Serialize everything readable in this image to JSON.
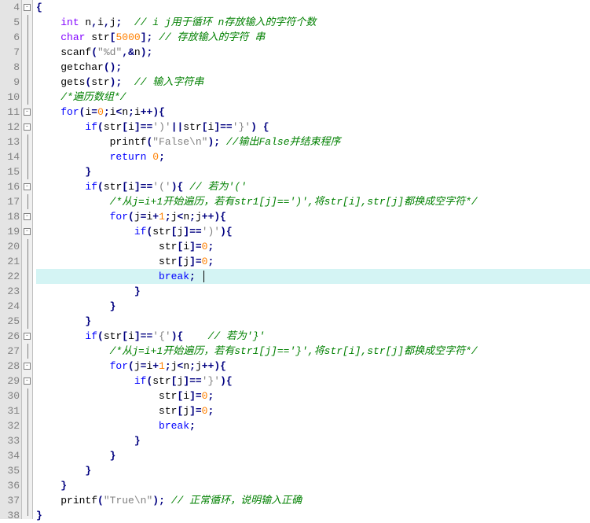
{
  "editor": {
    "active_line": 22,
    "gutter_start": 4,
    "gutter_end": 38,
    "fold_lines": [
      4,
      11,
      12,
      16,
      18,
      19,
      26,
      28,
      29
    ]
  },
  "code_lines": [
    {
      "n": 4,
      "indent": 0,
      "tokens": [
        {
          "t": "op",
          "v": "{"
        }
      ]
    },
    {
      "n": 5,
      "indent": 1,
      "tokens": [
        {
          "t": "type",
          "v": "int"
        },
        {
          "t": "plain",
          "v": " n"
        },
        {
          "t": "op",
          "v": ","
        },
        {
          "t": "plain",
          "v": "i"
        },
        {
          "t": "op",
          "v": ","
        },
        {
          "t": "plain",
          "v": "j"
        },
        {
          "t": "op",
          "v": ";"
        },
        {
          "t": "plain",
          "v": "  "
        },
        {
          "t": "cmt",
          "v": "// i j用于循环 n存放输入的字符个数"
        }
      ]
    },
    {
      "n": 6,
      "indent": 1,
      "tokens": [
        {
          "t": "type",
          "v": "char"
        },
        {
          "t": "plain",
          "v": " str"
        },
        {
          "t": "op",
          "v": "["
        },
        {
          "t": "num",
          "v": "5000"
        },
        {
          "t": "op",
          "v": "];"
        },
        {
          "t": "plain",
          "v": " "
        },
        {
          "t": "cmt",
          "v": "// 存放输入的字符 串"
        }
      ]
    },
    {
      "n": 7,
      "indent": 1,
      "tokens": [
        {
          "t": "fn",
          "v": "scanf"
        },
        {
          "t": "op",
          "v": "("
        },
        {
          "t": "str",
          "v": "\"%d\""
        },
        {
          "t": "op",
          "v": ",&"
        },
        {
          "t": "plain",
          "v": "n"
        },
        {
          "t": "op",
          "v": ");"
        }
      ]
    },
    {
      "n": 8,
      "indent": 1,
      "tokens": [
        {
          "t": "fn",
          "v": "getchar"
        },
        {
          "t": "op",
          "v": "();"
        }
      ]
    },
    {
      "n": 9,
      "indent": 1,
      "tokens": [
        {
          "t": "fn",
          "v": "gets"
        },
        {
          "t": "op",
          "v": "("
        },
        {
          "t": "plain",
          "v": "str"
        },
        {
          "t": "op",
          "v": ");"
        },
        {
          "t": "plain",
          "v": "  "
        },
        {
          "t": "cmt",
          "v": "// 输入字符串"
        }
      ]
    },
    {
      "n": 10,
      "indent": 1,
      "tokens": [
        {
          "t": "cmt",
          "v": "/*遍历数组*/"
        }
      ]
    },
    {
      "n": 11,
      "indent": 1,
      "tokens": [
        {
          "t": "kw",
          "v": "for"
        },
        {
          "t": "op",
          "v": "("
        },
        {
          "t": "plain",
          "v": "i"
        },
        {
          "t": "op",
          "v": "="
        },
        {
          "t": "num",
          "v": "0"
        },
        {
          "t": "op",
          "v": ";"
        },
        {
          "t": "plain",
          "v": "i"
        },
        {
          "t": "op",
          "v": "<"
        },
        {
          "t": "plain",
          "v": "n"
        },
        {
          "t": "op",
          "v": ";"
        },
        {
          "t": "plain",
          "v": "i"
        },
        {
          "t": "op",
          "v": "++){"
        }
      ]
    },
    {
      "n": 12,
      "indent": 2,
      "tokens": [
        {
          "t": "kw",
          "v": "if"
        },
        {
          "t": "op",
          "v": "("
        },
        {
          "t": "plain",
          "v": "str"
        },
        {
          "t": "op",
          "v": "["
        },
        {
          "t": "plain",
          "v": "i"
        },
        {
          "t": "op",
          "v": "]=="
        },
        {
          "t": "str",
          "v": "')'"
        },
        {
          "t": "op",
          "v": "||"
        },
        {
          "t": "plain",
          "v": "str"
        },
        {
          "t": "op",
          "v": "["
        },
        {
          "t": "plain",
          "v": "i"
        },
        {
          "t": "op",
          "v": "]=="
        },
        {
          "t": "str",
          "v": "'}'"
        },
        {
          "t": "op",
          "v": ") {"
        }
      ]
    },
    {
      "n": 13,
      "indent": 3,
      "tokens": [
        {
          "t": "fn",
          "v": "printf"
        },
        {
          "t": "op",
          "v": "("
        },
        {
          "t": "str",
          "v": "\"False\\n\""
        },
        {
          "t": "op",
          "v": ");"
        },
        {
          "t": "plain",
          "v": " "
        },
        {
          "t": "cmt",
          "v": "//输出False并结束程序"
        }
      ]
    },
    {
      "n": 14,
      "indent": 3,
      "tokens": [
        {
          "t": "kw",
          "v": "return"
        },
        {
          "t": "plain",
          "v": " "
        },
        {
          "t": "num",
          "v": "0"
        },
        {
          "t": "op",
          "v": ";"
        }
      ]
    },
    {
      "n": 15,
      "indent": 2,
      "tokens": [
        {
          "t": "op",
          "v": "}"
        }
      ]
    },
    {
      "n": 16,
      "indent": 2,
      "tokens": [
        {
          "t": "kw",
          "v": "if"
        },
        {
          "t": "op",
          "v": "("
        },
        {
          "t": "plain",
          "v": "str"
        },
        {
          "t": "op",
          "v": "["
        },
        {
          "t": "plain",
          "v": "i"
        },
        {
          "t": "op",
          "v": "]=="
        },
        {
          "t": "str",
          "v": "'('"
        },
        {
          "t": "op",
          "v": "){"
        },
        {
          "t": "plain",
          "v": " "
        },
        {
          "t": "cmt",
          "v": "// 若为'('"
        }
      ]
    },
    {
      "n": 17,
      "indent": 3,
      "tokens": [
        {
          "t": "cmt",
          "v": "/*从j=i+1开始遍历，若有str1[j]==')',将str[i],str[j]都换成空字符*/"
        }
      ]
    },
    {
      "n": 18,
      "indent": 3,
      "tokens": [
        {
          "t": "kw",
          "v": "for"
        },
        {
          "t": "op",
          "v": "("
        },
        {
          "t": "plain",
          "v": "j"
        },
        {
          "t": "op",
          "v": "="
        },
        {
          "t": "plain",
          "v": "i"
        },
        {
          "t": "op",
          "v": "+"
        },
        {
          "t": "num",
          "v": "1"
        },
        {
          "t": "op",
          "v": ";"
        },
        {
          "t": "plain",
          "v": "j"
        },
        {
          "t": "op",
          "v": "<"
        },
        {
          "t": "plain",
          "v": "n"
        },
        {
          "t": "op",
          "v": ";"
        },
        {
          "t": "plain",
          "v": "j"
        },
        {
          "t": "op",
          "v": "++){"
        }
      ]
    },
    {
      "n": 19,
      "indent": 4,
      "tokens": [
        {
          "t": "kw",
          "v": "if"
        },
        {
          "t": "op",
          "v": "("
        },
        {
          "t": "plain",
          "v": "str"
        },
        {
          "t": "op",
          "v": "["
        },
        {
          "t": "plain",
          "v": "j"
        },
        {
          "t": "op",
          "v": "]=="
        },
        {
          "t": "str",
          "v": "')'"
        },
        {
          "t": "op",
          "v": "){"
        }
      ]
    },
    {
      "n": 20,
      "indent": 5,
      "tokens": [
        {
          "t": "plain",
          "v": "str"
        },
        {
          "t": "op",
          "v": "["
        },
        {
          "t": "plain",
          "v": "i"
        },
        {
          "t": "op",
          "v": "]="
        },
        {
          "t": "num",
          "v": "0"
        },
        {
          "t": "op",
          "v": ";"
        }
      ]
    },
    {
      "n": 21,
      "indent": 5,
      "tokens": [
        {
          "t": "plain",
          "v": "str"
        },
        {
          "t": "op",
          "v": "["
        },
        {
          "t": "plain",
          "v": "j"
        },
        {
          "t": "op",
          "v": "]="
        },
        {
          "t": "num",
          "v": "0"
        },
        {
          "t": "op",
          "v": ";"
        }
      ]
    },
    {
      "n": 22,
      "indent": 5,
      "tokens": [
        {
          "t": "kw",
          "v": "break"
        },
        {
          "t": "op",
          "v": ";"
        },
        {
          "t": "caret",
          "v": ""
        }
      ],
      "active": true
    },
    {
      "n": 23,
      "indent": 4,
      "tokens": [
        {
          "t": "op",
          "v": "}"
        }
      ]
    },
    {
      "n": 24,
      "indent": 3,
      "tokens": [
        {
          "t": "op",
          "v": "}"
        }
      ]
    },
    {
      "n": 25,
      "indent": 2,
      "tokens": [
        {
          "t": "op",
          "v": "}"
        }
      ]
    },
    {
      "n": 26,
      "indent": 2,
      "tokens": [
        {
          "t": "kw",
          "v": "if"
        },
        {
          "t": "op",
          "v": "("
        },
        {
          "t": "plain",
          "v": "str"
        },
        {
          "t": "op",
          "v": "["
        },
        {
          "t": "plain",
          "v": "i"
        },
        {
          "t": "op",
          "v": "]=="
        },
        {
          "t": "str",
          "v": "'{'"
        },
        {
          "t": "op",
          "v": "){"
        },
        {
          "t": "plain",
          "v": "    "
        },
        {
          "t": "cmt",
          "v": "// 若为'}'"
        }
      ]
    },
    {
      "n": 27,
      "indent": 3,
      "tokens": [
        {
          "t": "cmt",
          "v": "/*从j=i+1开始遍历，若有str1[j]=='}',将str[i],str[j]都换成空字符*/"
        }
      ]
    },
    {
      "n": 28,
      "indent": 3,
      "tokens": [
        {
          "t": "kw",
          "v": "for"
        },
        {
          "t": "op",
          "v": "("
        },
        {
          "t": "plain",
          "v": "j"
        },
        {
          "t": "op",
          "v": "="
        },
        {
          "t": "plain",
          "v": "i"
        },
        {
          "t": "op",
          "v": "+"
        },
        {
          "t": "num",
          "v": "1"
        },
        {
          "t": "op",
          "v": ";"
        },
        {
          "t": "plain",
          "v": "j"
        },
        {
          "t": "op",
          "v": "<"
        },
        {
          "t": "plain",
          "v": "n"
        },
        {
          "t": "op",
          "v": ";"
        },
        {
          "t": "plain",
          "v": "j"
        },
        {
          "t": "op",
          "v": "++){"
        }
      ]
    },
    {
      "n": 29,
      "indent": 4,
      "tokens": [
        {
          "t": "kw",
          "v": "if"
        },
        {
          "t": "op",
          "v": "("
        },
        {
          "t": "plain",
          "v": "str"
        },
        {
          "t": "op",
          "v": "["
        },
        {
          "t": "plain",
          "v": "j"
        },
        {
          "t": "op",
          "v": "]=="
        },
        {
          "t": "str",
          "v": "'}'"
        },
        {
          "t": "op",
          "v": "){"
        }
      ]
    },
    {
      "n": 30,
      "indent": 5,
      "tokens": [
        {
          "t": "plain",
          "v": "str"
        },
        {
          "t": "op",
          "v": "["
        },
        {
          "t": "plain",
          "v": "i"
        },
        {
          "t": "op",
          "v": "]="
        },
        {
          "t": "num",
          "v": "0"
        },
        {
          "t": "op",
          "v": ";"
        }
      ]
    },
    {
      "n": 31,
      "indent": 5,
      "tokens": [
        {
          "t": "plain",
          "v": "str"
        },
        {
          "t": "op",
          "v": "["
        },
        {
          "t": "plain",
          "v": "j"
        },
        {
          "t": "op",
          "v": "]="
        },
        {
          "t": "num",
          "v": "0"
        },
        {
          "t": "op",
          "v": ";"
        }
      ]
    },
    {
      "n": 32,
      "indent": 5,
      "tokens": [
        {
          "t": "kw",
          "v": "break"
        },
        {
          "t": "op",
          "v": ";"
        }
      ]
    },
    {
      "n": 33,
      "indent": 4,
      "tokens": [
        {
          "t": "op",
          "v": "}"
        }
      ]
    },
    {
      "n": 34,
      "indent": 3,
      "tokens": [
        {
          "t": "op",
          "v": "}"
        }
      ]
    },
    {
      "n": 35,
      "indent": 2,
      "tokens": [
        {
          "t": "op",
          "v": "}"
        }
      ]
    },
    {
      "n": 36,
      "indent": 1,
      "tokens": [
        {
          "t": "op",
          "v": "}"
        }
      ]
    },
    {
      "n": 37,
      "indent": 1,
      "tokens": [
        {
          "t": "fn",
          "v": "printf"
        },
        {
          "t": "op",
          "v": "("
        },
        {
          "t": "str",
          "v": "\"True\\n\""
        },
        {
          "t": "op",
          "v": ");"
        },
        {
          "t": "plain",
          "v": " "
        },
        {
          "t": "cmt",
          "v": "// 正常循环，说明输入正确"
        }
      ]
    },
    {
      "n": 38,
      "indent": 0,
      "tokens": [
        {
          "t": "op",
          "v": "}"
        }
      ]
    }
  ]
}
